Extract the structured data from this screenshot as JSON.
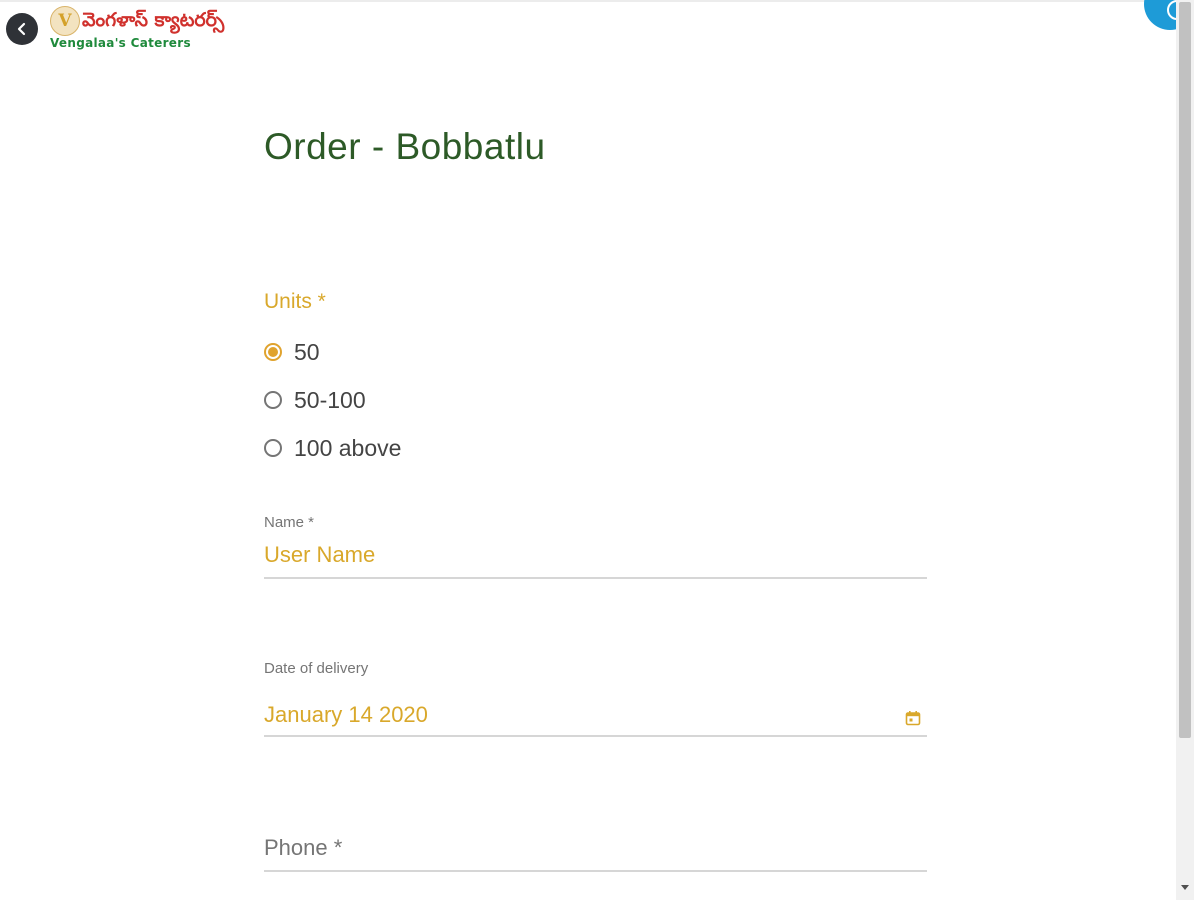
{
  "header": {
    "logo_telugu": "వెంగళాస్ క్యాటరర్స్",
    "logo_english": "Vengalaa's Caterers",
    "logo_emblem": "V"
  },
  "page": {
    "title": "Order - Bobbatlu"
  },
  "units": {
    "label": "Units *",
    "options": [
      "50",
      "50-100",
      "100 above"
    ],
    "selected": "50"
  },
  "name_field": {
    "label": "Name *",
    "value": "User Name"
  },
  "date_field": {
    "label": "Date of delivery",
    "value": "January 14 2020"
  },
  "phone_field": {
    "placeholder": "Phone *"
  },
  "colors": {
    "accent": "#e0a32e",
    "title": "#2d5a27",
    "back_button": "#2f3237",
    "float_button": "#1e9bd7"
  },
  "icons": {
    "back": "chevron-left-icon",
    "calendar": "calendar-icon"
  }
}
